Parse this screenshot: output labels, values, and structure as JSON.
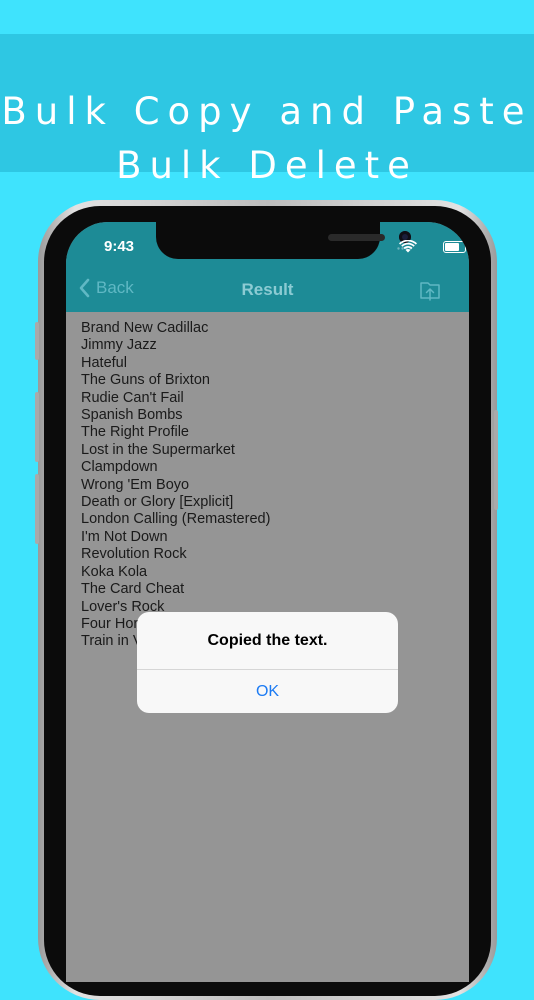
{
  "banner": {
    "line1": "Bulk Copy and Paste",
    "line2": "Bulk Delete"
  },
  "status_bar": {
    "time": "9:43",
    "icons": [
      "signal-icon",
      "wifi-icon",
      "battery-icon"
    ]
  },
  "nav": {
    "back_label": "Back",
    "title": "Result",
    "share_icon": "share-icon"
  },
  "result_lines": [
    "Brand New Cadillac",
    "Jimmy Jazz",
    "Hateful",
    "The Guns of Brixton",
    "Rudie Can't Fail",
    "Spanish Bombs",
    "The Right Profile",
    "Lost in the Supermarket",
    "Clampdown",
    "Wrong 'Em Boyo",
    "Death or Glory [Explicit]",
    "London Calling (Remastered)",
    "I'm Not Down",
    "Revolution Rock",
    "Koka Kola",
    "The Card Cheat",
    "Lover's Rock",
    "Four Horsemen",
    "Train in Vain"
  ],
  "alert": {
    "message": "Copied the text.",
    "ok_label": "OK"
  },
  "colors": {
    "background": "#3fe3fd",
    "banner": "#2ec7e3",
    "navbar": "#1d8b96",
    "content": "#959595",
    "alert_button": "#1c7bf3"
  }
}
